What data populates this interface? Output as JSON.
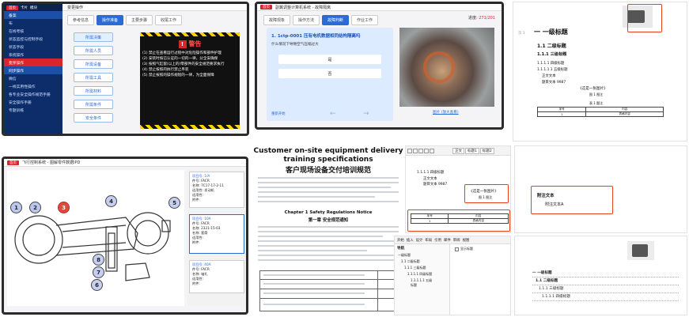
{
  "s1": {
    "sidebar": [
      "备案",
      "布",
      "在线考核",
      "状态监控与控制手段",
      "状态手段",
      "系统操作",
      "变序操作",
      "同步操作",
      "微信",
      "一线实用性操作",
      "各专业安全操作规范手册",
      "安全操作手册",
      "专题训练"
    ],
    "top_tabs": [
      "首页",
      "卡片",
      "模块",
      "变更操作"
    ],
    "content_tabs": [
      "参考信息",
      "操作准备",
      "主要步骤",
      "收尾工作"
    ],
    "buttons": [
      "所需决策",
      "所需人员",
      "所需设备",
      "所需工具",
      "所需材料",
      "所需条件",
      "安全条件"
    ],
    "warn_title": "警告",
    "warn_items": [
      "(1) 禁止在查看运行过程中对危险操作和部件护理",
      "(2) 安装时按已认证的一切的一律，分全安确保",
      "(3) 按照气缸套(以上的)零部件的安全规范要求执行",
      "(4) 禁止按照的执行禁止吊装",
      "(5) 禁止按照的操作规程的一律，为全面保障"
    ]
  },
  "s2": {
    "title": "副翼调整计算机系统 - 故障隔离",
    "tabs": [
      "故障现象",
      "操作方法",
      "故障判断",
      "作业工作"
    ],
    "badge": "271/201",
    "question": "1. 1ctp-0001 压有电机数据相同结构隔离吗",
    "sub": "什么情况下导致空气压缩过大",
    "opt1": "是",
    "opt2": "否",
    "link": "图片 (放大查看)",
    "foot_left": "重新开始"
  },
  "s3": {
    "title": "一 一级标题",
    "h2": "1.1 二级标题",
    "h2b": "1.1.1 三级标题",
    "lines": [
      "1.1.1.1 四级标题",
      "1.1.1.1.1 五级标题",
      "正文文本",
      "题目文本 9987"
    ],
    "caption": "《这是一张图片》",
    "caption2": "图 1 图注",
    "tbl_caption": "表 1 题注",
    "tbl_head": [
      "序号",
      "内容"
    ],
    "tbl_row": [
      "1",
      "表格内容"
    ],
    "margin": "页 1"
  },
  "s4": {
    "title": "飞行控制系统 - 图解零件数据IPD",
    "tag": "首页",
    "labels": [
      "1",
      "2",
      "3",
      "4",
      "5",
      "6",
      "7",
      "8"
    ],
    "cards": [
      {
        "head": "项目号: 1/A",
        "rows": [
          "件号: FACR",
          "名称: 7C17-17-2-11",
          "适用性: 发动机",
          "适用性:",
          "附件:"
        ]
      },
      {
        "head": "项目号: 10A",
        "rows": [
          "件号: FACR",
          "名称: 2321-15-03",
          "名称: 套筒",
          "适用性:",
          "附件:"
        ]
      },
      {
        "head": "项目号: 40A",
        "rows": [
          "件号: FACR",
          "名称: 轴孔",
          "适用性:",
          "附件:"
        ]
      }
    ]
  },
  "s5": {
    "title_en": "Customer on-site equipment delivery training specifications",
    "title_cn": "客户现场设备交付培训规范",
    "chapter_en": "Chapter 1 Safety Regulations Notice",
    "chapter_cn": "第一章 安全规范通知"
  },
  "s6": {
    "toolbar": [
      "正文",
      "标题1",
      "标题2"
    ],
    "caption": "《这是一张图片》",
    "caption2": "图 1 图注",
    "heading_lines": [
      "1.1.1.1 四级标题",
      "正文文本",
      "题目文本 9987"
    ],
    "tbl_head": [
      "序号",
      "内容"
    ],
    "tbl_row": [
      "1",
      "表格内容"
    ],
    "appendix": "附注文本",
    "appendix2": "附注文本A"
  },
  "s7": {
    "menu": [
      "开始",
      "插入",
      "设计",
      "布局",
      "引用",
      "邮件",
      "审阅",
      "视图"
    ],
    "tree_title": "导航",
    "tree_checkbox": "显示标题",
    "tree": [
      "一级标题",
      "1.1 二级标题",
      "1.1.1 三级标题",
      "1.1.1.1 四级标题",
      "1.1.1.1.1 五级标题"
    ],
    "toc": [
      "一 一级标题",
      "1.1 二级标题",
      "1.1.1 三级标题",
      "1.1.1.1 四级标题"
    ]
  }
}
